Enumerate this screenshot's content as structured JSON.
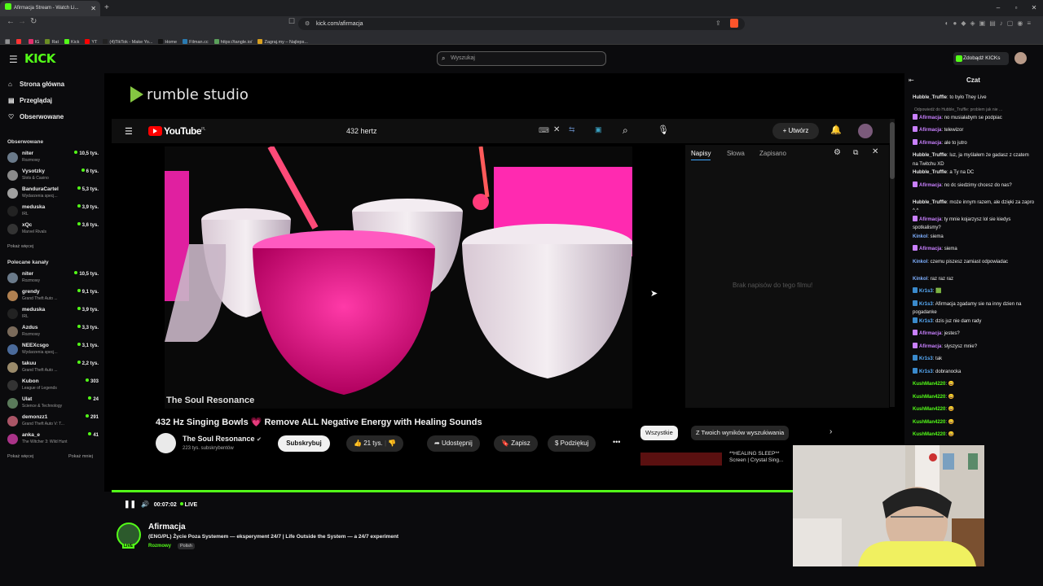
{
  "browser": {
    "tab_title": "Afirmacja Stream - Watch Li...",
    "new_tab": "+",
    "url": "kick.com/afirmacja",
    "bookmarks": [
      {
        "label": "IG",
        "color": "#e1306c"
      },
      {
        "label": "Rat",
        "color": "#6b8e23"
      },
      {
        "label": "Kick",
        "color": "#53fc18"
      },
      {
        "label": "YT",
        "color": "#ff0000"
      },
      {
        "label": "(4)TikTok - Make Yo...",
        "color": "#222222"
      },
      {
        "label": "Home",
        "color": "#111111"
      },
      {
        "label": "Filman.cc",
        "color": "#2a7ab0"
      },
      {
        "label": "https://tangle.io/",
        "color": "#5aa05a"
      },
      {
        "label": "Zagraj.my – Najleps...",
        "color": "#d8a020"
      }
    ]
  },
  "kick": {
    "logo": "KICK",
    "search_placeholder": "Wyszukaj",
    "kicks_button": "Zdobądź KICKs",
    "nav": [
      {
        "label": "Strona główna",
        "icon": "home-icon",
        "glyph": "⌂"
      },
      {
        "label": "Przeglądaj",
        "icon": "browse-icon",
        "glyph": "▤"
      },
      {
        "label": "Obserwowane",
        "icon": "heart-icon",
        "glyph": "♡"
      }
    ],
    "followed_heading": "Obserwowane",
    "followed": [
      {
        "name": "niter",
        "category": "Rozmowy",
        "viewers": "10,5 tys.",
        "color": "#6a7a8a"
      },
      {
        "name": "Vysotzky",
        "category": "Slots & Casino",
        "viewers": "6 tys.",
        "color": "#8a8a8a"
      },
      {
        "name": "BanduraCartel",
        "category": "Wydarzenia specj...",
        "viewers": "5,3 tys.",
        "color": "#a0a0a0"
      },
      {
        "name": "meduska",
        "category": "IRL",
        "viewers": "3,9 tys.",
        "color": "#222222"
      },
      {
        "name": "xQc",
        "category": "Marvel Rivals",
        "viewers": "3,6 tys.",
        "color": "#333333"
      }
    ],
    "show_more": "Pokaż więcej",
    "recommended_heading": "Polecane kanały",
    "recommended": [
      {
        "name": "niter",
        "category": "Rozmowy",
        "viewers": "10,5 tys.",
        "color": "#6a7a8a"
      },
      {
        "name": "grendy",
        "category": "Grand Theft Auto ...",
        "viewers": "9,1 tys.",
        "color": "#b08050"
      },
      {
        "name": "meduska",
        "category": "IRL",
        "viewers": "3,9 tys.",
        "color": "#222222"
      },
      {
        "name": "Azdus",
        "category": "Rozmowy",
        "viewers": "3,3 tys.",
        "color": "#7a6a5a"
      },
      {
        "name": "NEEXcsgo",
        "category": "Wydarzenia specj...",
        "viewers": "3,1 tys.",
        "color": "#4a6a9a"
      },
      {
        "name": "takuu",
        "category": "Grand Theft Auto ...",
        "viewers": "2,2 tys.",
        "color": "#9a8a6a"
      },
      {
        "name": "Kubon",
        "category": "League of Legends",
        "viewers": "303",
        "color": "#333333"
      },
      {
        "name": "Ulat",
        "category": "Science & Technology",
        "viewers": "24",
        "color": "#5a7a5a"
      },
      {
        "name": "demonzz1",
        "category": "Grand Theft Auto V: T...",
        "viewers": "291",
        "color": "#aa5566"
      },
      {
        "name": "anka_e",
        "category": "The Witcher 3: Wild Hunt",
        "viewers": "41",
        "color": "#aa3388"
      }
    ],
    "show_more_2": "Pokaż więcej",
    "show_less": "Pokaż mniej"
  },
  "youtube": {
    "rumble": "rumble studio",
    "logo": "YouTube",
    "logo_region": "PL",
    "search_query": "432 hertz",
    "create_button": "Utwórz",
    "video_watermark": "The Soul Resonance",
    "caption_tabs": [
      "Napisy",
      "Słowa",
      "Zapisano"
    ],
    "no_captions": "Brak napisów do tego filmu!",
    "title": "432 Hz Singing Bowls 💗 Remove ALL Negative Energy with Healing Sounds",
    "channel": "The Soul Resonance",
    "subscribers": "223 tys. subskrybentów",
    "subscribe": "Subskrybuj",
    "likes": "21 tys.",
    "share": "Udostępnij",
    "save": "Zapisz",
    "thanks": "Podziękuj",
    "more": "•••",
    "chip_all": "Wszystkie",
    "chip_search": "Z Twoich wyników wyszukiwania",
    "related": "**HEALING SLEEP**\nScreen | Crystal Sing..."
  },
  "player": {
    "time": "00:07:02",
    "live": "LIVE",
    "progress": 1.0
  },
  "stream": {
    "streamer": "Afirmacja",
    "title": "(ENG/PL) Życie Poza Systemem — eksperyment 24/7 | Life Outside the System — a 24/7 experiment",
    "category": "Rozmowy",
    "language": "Polish",
    "live_badge": "LIVE"
  },
  "chat": {
    "header": "Czat",
    "messages": [
      {
        "user": "Hubble_Truffle",
        "text": ": to było They Live",
        "color": "#e8e8e8",
        "badge": ""
      },
      {
        "reply": "Odpowiedź do Hubble_Truffle: problem jak nie ..."
      },
      {
        "user": "Afirmacja",
        "text": ": no musiałabym se podpiac",
        "color": "#c980ff",
        "badge": "#c980ff"
      },
      {
        "user": "Afirmacja",
        "text": ": telewizor",
        "color": "#c980ff",
        "badge": "#c980ff"
      },
      {
        "user": "Afirmacja",
        "text": ": ale to jutro",
        "color": "#c980ff",
        "badge": "#c980ff"
      },
      {
        "user": "Hubble_Truffle",
        "text": ": luz, ja myślałem że gadasz z czatem na Twitchu XD",
        "color": "#e8e8e8",
        "badge": ""
      },
      {
        "user": "Hubble_Truffle",
        "text": ": a Ty na DC",
        "color": "#e8e8e8",
        "badge": ""
      },
      {
        "user": "Afirmacja",
        "text": ": no dc siedzimy chcesz do nas?",
        "color": "#c980ff",
        "badge": "#c980ff"
      },
      {
        "user": "Hubble_Truffle",
        "text": ": może innym razem, ale dzięki za zapro ^.^",
        "color": "#e8e8e8",
        "badge": ""
      },
      {
        "user": "Afirmacja",
        "text": ": ty mnie kojarzysz lol sie kiedys spotkalismy?",
        "color": "#c980ff",
        "badge": "#c980ff"
      },
      {
        "user": "Kinkol",
        "text": ": siema",
        "color": "#7fb0ff",
        "badge": ""
      },
      {
        "user": "Afirmacja",
        "text": ": siema",
        "color": "#c980ff",
        "badge": "#c980ff"
      },
      {
        "user": "Kinkol",
        "text": ": czemu piszesz zamiast odpowiadac",
        "color": "#7fb0ff",
        "badge": ""
      },
      {
        "user": "Kinkol",
        "text": ": raz raz raz",
        "color": "#7fb0ff",
        "badge": ""
      },
      {
        "user": "Kr1s3",
        "text": ": 🟩",
        "color": "#5ab0ff",
        "badge": "#3a8acc"
      },
      {
        "user": "Kr1s3",
        "text": ": Afirmacja zgadamy sie na inny dzien na pogadanke",
        "color": "#5ab0ff",
        "badge": "#3a8acc"
      },
      {
        "user": "Kr1s3",
        "text": ": dzis juz nie dam rady",
        "color": "#5ab0ff",
        "badge": "#3a8acc"
      },
      {
        "user": "Afirmacja",
        "text": ": jestes?",
        "color": "#c980ff",
        "badge": "#c980ff"
      },
      {
        "user": "Afirmacja",
        "text": ": slyszysz mnie?",
        "color": "#c980ff",
        "badge": "#c980ff"
      },
      {
        "user": "Kr1s3",
        "text": ": tak",
        "color": "#5ab0ff",
        "badge": "#3a8acc"
      },
      {
        "user": "Kr1s3",
        "text": ": dobranocka",
        "color": "#5ab0ff",
        "badge": "#3a8acc"
      },
      {
        "user": "KushMan4220",
        "text": ": 😀",
        "color": "#53fc18",
        "badge": ""
      },
      {
        "user": "KushMan4220",
        "text": ": 😀",
        "color": "#53fc18",
        "badge": ""
      },
      {
        "user": "KushMan4220",
        "text": ": 😀",
        "color": "#53fc18",
        "badge": ""
      },
      {
        "user": "KushMan4220",
        "text": ": 😀",
        "color": "#53fc18",
        "badge": ""
      },
      {
        "user": "KushMan4220",
        "text": ": 😀",
        "color": "#53fc18",
        "badge": ""
      }
    ]
  }
}
